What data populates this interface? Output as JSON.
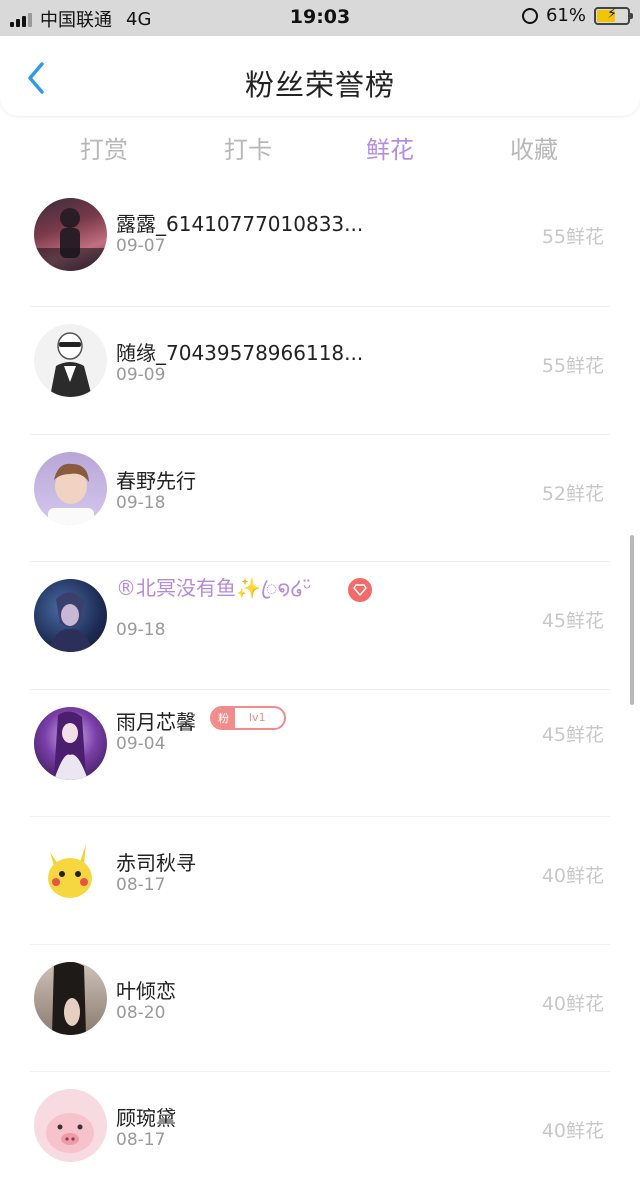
{
  "status_bar": {
    "carrier": "中国联通",
    "network": "4G",
    "time": "19:03",
    "battery": "61%",
    "battery_level": 0.61,
    "battery_color": "#f4c400"
  },
  "header": {
    "title": "粉丝荣誉榜",
    "back_icon": "chevron-left-icon",
    "accent": "#2e9be6"
  },
  "tabs": [
    {
      "label": "打赏"
    },
    {
      "label": "打卡"
    },
    {
      "label": "鲜花",
      "active": true
    },
    {
      "label": "收藏"
    }
  ],
  "active_color": "#b48ee6",
  "rows": [
    {
      "name": "露露_61410777010833...",
      "date": "09-07",
      "amount": "55鲜花"
    },
    {
      "name": "随缘_70439578966118...",
      "date": "09-09",
      "amount": "55鲜花"
    },
    {
      "name": "春野先行",
      "date": "09-18",
      "amount": "52鲜花"
    },
    {
      "name": "®北冥没有鱼✨ꦿ໑໒ᵕ̈",
      "date": "09-18",
      "amount": "45鲜花",
      "vip_icon": "diamond-icon"
    },
    {
      "name": "雨月芯馨",
      "date": "09-04",
      "amount": "45鲜花",
      "badge": {
        "label": "粉",
        "level": "lv1"
      }
    },
    {
      "name": "赤司秋寻",
      "date": "08-17",
      "amount": "40鲜花"
    },
    {
      "name": "叶倾恋",
      "date": "08-20",
      "amount": "40鲜花"
    },
    {
      "name": "顾琬黛",
      "date": "08-17",
      "amount": "40鲜花"
    }
  ]
}
